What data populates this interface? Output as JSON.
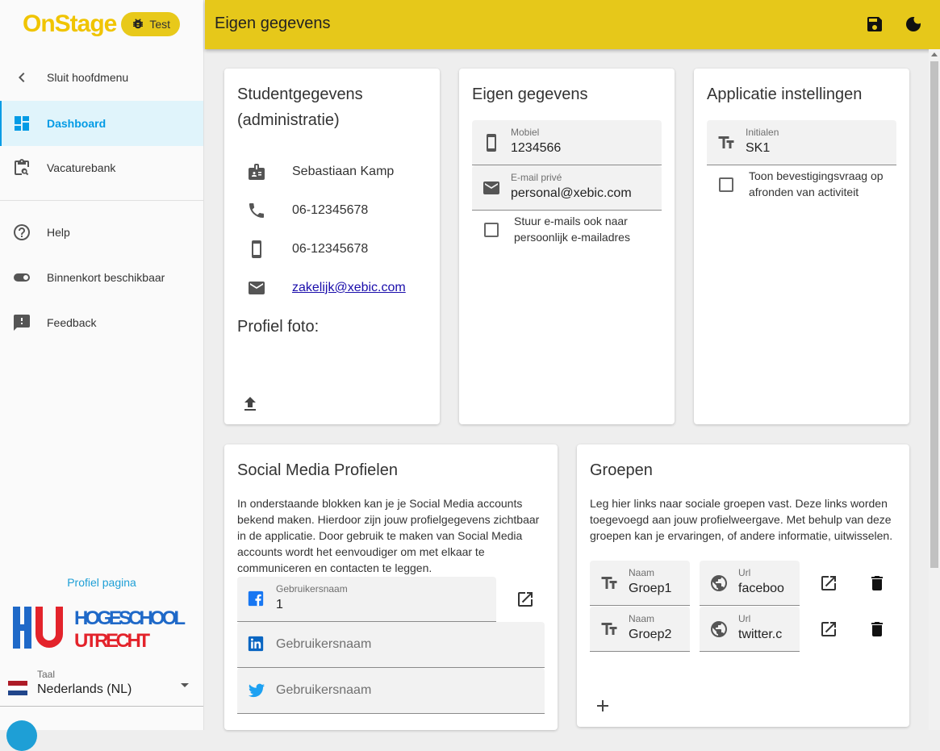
{
  "app": {
    "logo_text": "OnStage",
    "env_badge": "Test",
    "accent_color": "#e6c81a",
    "link_color": "#039be5"
  },
  "sidebar": {
    "items": [
      {
        "label": "Sluit hoofdmenu",
        "icon": "chevron-left-icon"
      },
      {
        "label": "Dashboard",
        "icon": "dashboard-icon",
        "active": true
      },
      {
        "label": "Vacaturebank",
        "icon": "clipboard-search-icon"
      },
      {
        "label": "Help",
        "icon": "help-circle-icon"
      },
      {
        "label": "Binnenkort beschikbaar",
        "icon": "toggle-icon"
      },
      {
        "label": "Feedback",
        "icon": "feedback-icon"
      }
    ],
    "profile_link": "Profiel pagina",
    "school_logo": {
      "line1": "HOGESCHOOL",
      "line2": "UTRECHT"
    },
    "language": {
      "caption": "Taal",
      "value": "Nederlands (NL)"
    }
  },
  "header": {
    "title": "Eigen gegevens",
    "save_icon": "save-icon",
    "theme_icon": "dark-mode-icon"
  },
  "student_card": {
    "title": "Studentgegevens (administratie)",
    "name": "Sebastiaan Kamp",
    "phone": "06-12345678",
    "mobile": "06-12345678",
    "email": "zakelijk@xebic.com",
    "photo_title": "Profiel foto:"
  },
  "own_card": {
    "title": "Eigen gegevens",
    "mobile_caption": "Mobiel",
    "mobile_value": "1234566",
    "email_caption": "E-mail privé",
    "email_value": "personal@xebic.com",
    "checkbox_label": "Stuur e-mails ook naar persoonlijk e-mailadres",
    "checkbox_checked": false
  },
  "settings_card": {
    "title": "Applicatie instellingen",
    "initials_caption": "Initialen",
    "initials_value": "SK1",
    "checkbox_label": "Toon bevestigingsvraag op afronden van activiteit",
    "checkbox_checked": false
  },
  "social_card": {
    "title": "Social Media Profielen",
    "description": "In onderstaande blokken kan je je Social Media accounts bekend maken. Hierdoor zijn jouw profielgegevens zichtbaar in de applicatie. Door gebruik te maken van Social Media accounts wordt het eenvoudiger om met elkaar te communiceren en contacten te leggen.",
    "facebook": {
      "caption": "Gebruikersnaam",
      "value": "1"
    },
    "linkedin": {
      "placeholder": "Gebruikersnaam"
    },
    "twitter": {
      "placeholder": "Gebruikersnaam"
    }
  },
  "groups_card": {
    "title": "Groepen",
    "description": "Leg hier links naar sociale groepen vast. Deze links worden toegevoegd aan jouw profielweergave. Met behulp van deze groepen kan je ervaringen, of andere informatie, uitwisselen.",
    "name_caption": "Naam",
    "url_caption": "Url",
    "groups": [
      {
        "name": "Groep1",
        "url": "faceboo"
      },
      {
        "name": "Groep2",
        "url": "twitter.c"
      }
    ]
  }
}
